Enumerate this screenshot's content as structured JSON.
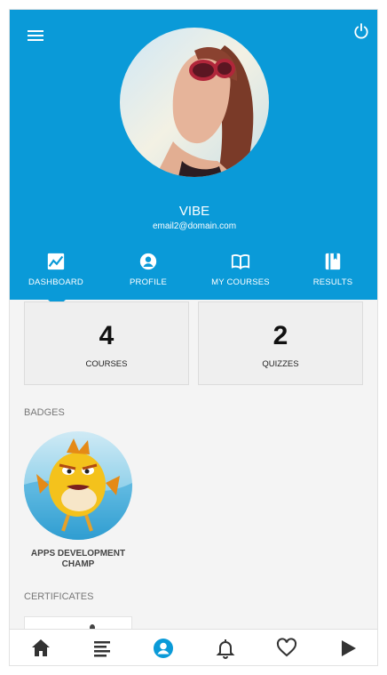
{
  "profile": {
    "name": "VIBE",
    "email": "email2@domain.com"
  },
  "nav": [
    {
      "label": "DASHBOARD",
      "icon": "chart-icon",
      "active": true
    },
    {
      "label": "PROFILE",
      "icon": "person-circle-icon",
      "active": false
    },
    {
      "label": "MY COURSES",
      "icon": "open-book-icon",
      "active": false
    },
    {
      "label": "RESULTS",
      "icon": "book-icon",
      "active": false
    }
  ],
  "stats": [
    {
      "value": "4",
      "label": "COURSES"
    },
    {
      "value": "2",
      "label": "QUIZZES"
    }
  ],
  "badges_title": "BADGES",
  "badges": [
    {
      "name": "APPS DEVELOPMENT CHAMP"
    }
  ],
  "certificates_title": "CERTIFICATES",
  "bottom_nav": [
    {
      "icon": "home-icon"
    },
    {
      "icon": "list-icon"
    },
    {
      "icon": "profile-icon",
      "active": true
    },
    {
      "icon": "bell-icon"
    },
    {
      "icon": "heart-icon"
    },
    {
      "icon": "play-icon"
    }
  ],
  "colors": {
    "primary": "#0a9ad8",
    "background": "#f4f4f4",
    "active_tab": "#0a9ad8",
    "inactive_tab": "#333333"
  }
}
